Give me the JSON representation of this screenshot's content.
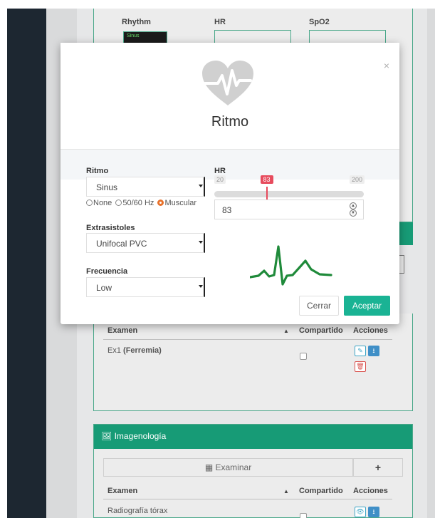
{
  "background": {
    "vitals_labels": [
      "Rhythm",
      "HR",
      "SpO2"
    ],
    "rhythm_mini": "Sinus",
    "exams_table": {
      "headers": [
        "Examen",
        "Compartido",
        "Acciones"
      ],
      "sort_glyph": "▲",
      "rows": [
        {
          "name": "Ex1",
          "detail": "(Ferremia)"
        }
      ]
    },
    "imagenologia": {
      "title": "Imagenología",
      "examinar_label": "Examinar",
      "add_label": "+",
      "headers": [
        "Examen",
        "Compartido",
        "Acciones"
      ],
      "sort_glyph": "▲",
      "rows": [
        {
          "name": "Radiografía tórax"
        }
      ]
    }
  },
  "modal": {
    "title": "Ritmo",
    "close_glyph": "×",
    "ritmo": {
      "label": "Ritmo",
      "value": "Sinus"
    },
    "filter": {
      "options": [
        "None",
        "50/60 Hz",
        "Muscular"
      ],
      "selected": "Muscular"
    },
    "extrasistoles": {
      "label": "Extrasistoles",
      "value": "Unifocal PVC"
    },
    "frecuencia": {
      "label": "Frecuencia",
      "value": "Low"
    },
    "hr": {
      "label": "HR",
      "min": "20",
      "max": "200",
      "value": "83",
      "fraction": 0.35
    },
    "buttons": {
      "cancel": "Cerrar",
      "accept": "Aceptar"
    },
    "colors": {
      "accent": "#1ab394",
      "slider": "#e74b5d",
      "ecg": "#1f8a3a",
      "heart": "#d0d0d0",
      "radio": "#e8712a"
    }
  }
}
